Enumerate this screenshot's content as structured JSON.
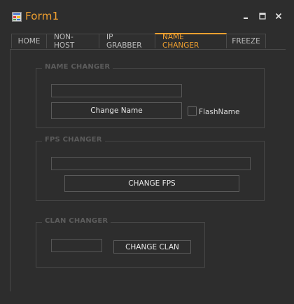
{
  "window": {
    "title": "Form1",
    "icon": "form-app-icon",
    "controls": {
      "minimize": "minimize-icon",
      "maximize": "maximize-icon",
      "close": "close-icon"
    }
  },
  "tabs": [
    {
      "label": "HOME"
    },
    {
      "label": "NON-HOST"
    },
    {
      "label": "IP GRABBER"
    },
    {
      "label": "NAME CHANGER",
      "active": true
    },
    {
      "label": "FREEZE"
    }
  ],
  "name_changer": {
    "group_label": "NAME CHANGER",
    "name_input_value": "",
    "change_name_label": "Change Name",
    "flash_label": "FlashName",
    "flash_checked": false
  },
  "fps_changer": {
    "group_label": "FPS CHANGER",
    "fps_input_value": "",
    "change_fps_label": "CHANGE FPS"
  },
  "clan_changer": {
    "group_label": "CLAN CHANGER",
    "clan_input_value": "",
    "change_clan_label": "CHANGE CLAN"
  },
  "colors": {
    "background": "#2d2d2d",
    "accent": "#f0a030",
    "border": "#4a4a4a",
    "group_label": "#5c5c5c"
  }
}
